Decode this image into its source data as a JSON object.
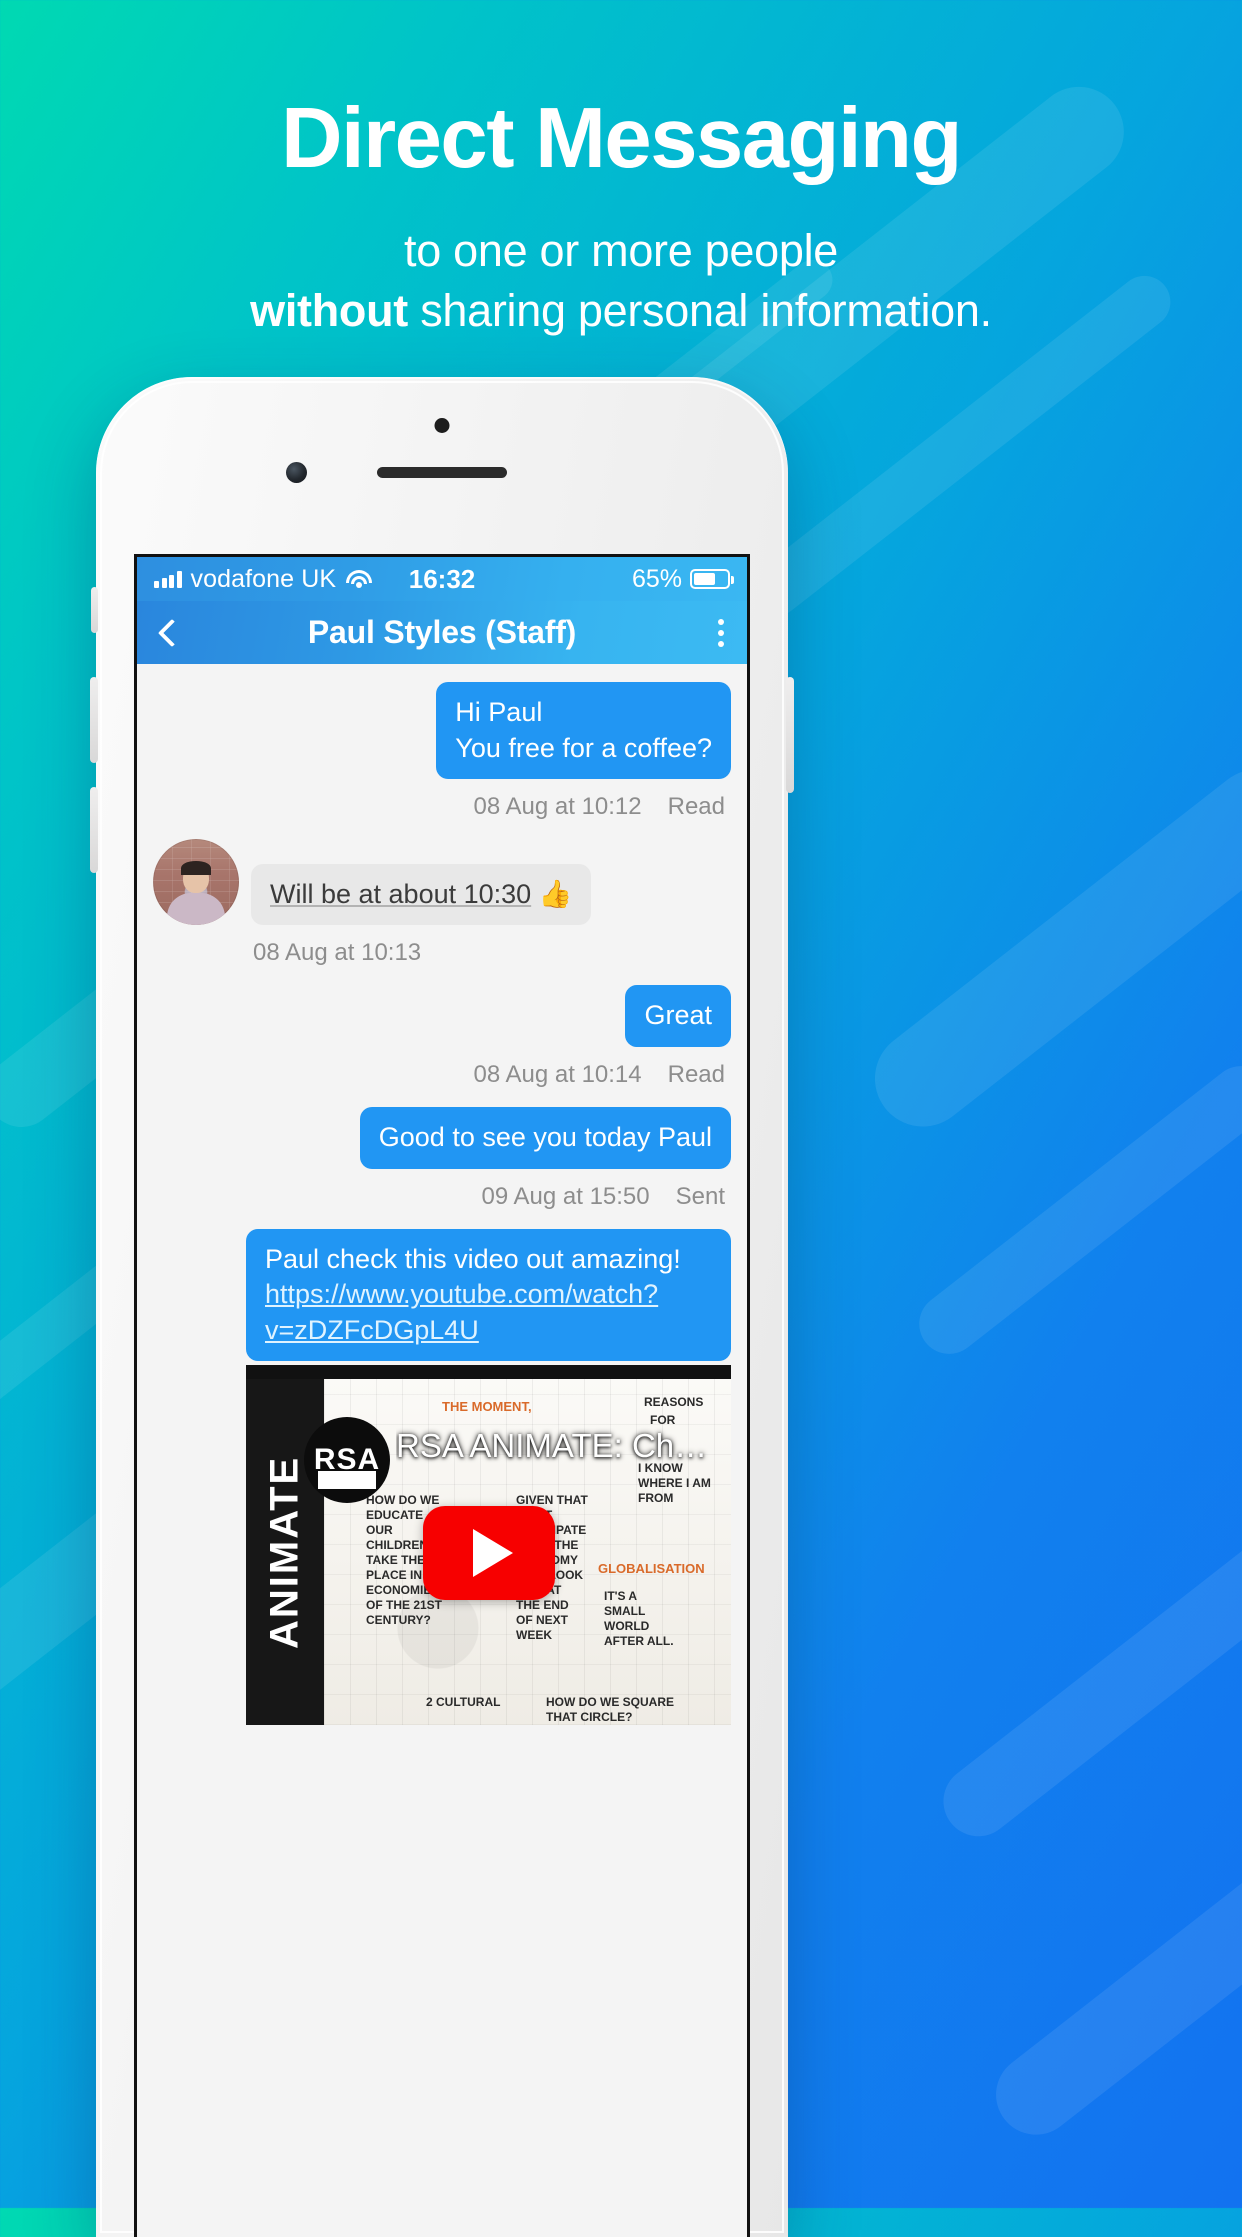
{
  "promo": {
    "headline": "Direct Messaging",
    "sub_line1": "to one or more people",
    "sub_line2_bold": "without",
    "sub_line2_rest": " sharing personal information."
  },
  "colors": {
    "bg_gradient_start": "#00d9b2",
    "bg_gradient_end": "#1272f0",
    "bubble_out": "#2196f3",
    "bubble_in": "#e8e8e8",
    "navbar_blue": "#2e9ae5",
    "youtube_red": "#f70000",
    "meta_text": "#8d8d8d"
  },
  "phone": {
    "status_bar": {
      "signal_icon": "signal-bars-icon",
      "carrier": "vodafone UK",
      "wifi_icon": "wifi-icon",
      "time": "16:32",
      "battery_percent": "65%",
      "battery_icon": "battery-icon",
      "battery_level": 65
    },
    "nav_bar": {
      "back_icon": "chevron-left-icon",
      "title": "Paul Styles (Staff)",
      "menu_icon": "kebab-menu-icon"
    },
    "conversation": [
      {
        "id": "msg-1",
        "direction": "out",
        "text_line1": "Hi Paul",
        "text_line2": "You free for a coffee?",
        "timestamp": "08 Aug at 10:12",
        "status": "Read"
      },
      {
        "id": "msg-2",
        "direction": "in",
        "avatar": "contact-avatar",
        "text": "Will be at about 10:30",
        "underlined_part": "at about 10:30",
        "emoji": "👍",
        "timestamp": "08 Aug at 10:13",
        "status": ""
      },
      {
        "id": "msg-3",
        "direction": "out",
        "text": "Great",
        "timestamp": "08 Aug at 10:14",
        "status": "Read"
      },
      {
        "id": "msg-4",
        "direction": "out",
        "text": "Good to see you today Paul",
        "timestamp": "09 Aug at 15:50",
        "status": "Sent"
      },
      {
        "id": "msg-5",
        "direction": "out",
        "text_prefix": "Paul check this video out amazing! ",
        "link_text": "https://www.youtube.com/watch?v=zDZFcDGpL4U"
      }
    ],
    "video_card": {
      "channel_badge": "RSA",
      "brand_vertical": "ANIMATE",
      "title": "RSA ANIMATE: Changing ...",
      "play_button_icon": "play-icon",
      "sketch_texts": {
        "top_center": "THE MOMENT,",
        "top_right": "REASONS",
        "top_right2": "FOR",
        "bubble_right": "I KNOW WHERE I AM FROM",
        "block_left": "HOW DO WE EDUCATE OUR CHILDREN TO TAKE THEIR PLACE IN THE ECONOMIES OF THE 21ST CENTURY?",
        "block_mid": "GIVEN THAT CAN'T ANTICIPATE WHAT THE ECONOMY WILL LOOK LIKE AT THE END OF NEXT WEEK",
        "globalisation": "GLOBALISATION",
        "small_world": "IT'S A SMALL WORLD AFTER ALL.",
        "bottom_left": "2 CULTURAL",
        "bottom_right": "HOW DO WE SQUARE THAT CIRCLE?"
      }
    }
  }
}
